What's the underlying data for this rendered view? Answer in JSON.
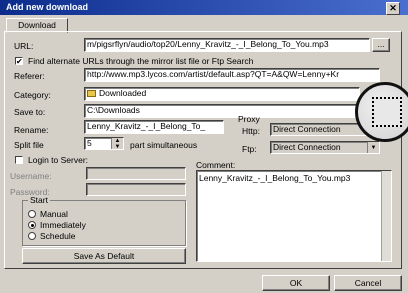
{
  "window": {
    "title": "Add new download",
    "close_glyph": "✕"
  },
  "tabs": [
    "Download"
  ],
  "url": {
    "label": "URL:",
    "value": "m/pigsrflyn/audio/top20/Lenny_Kravitz_-_I_Belong_To_You.mp3",
    "browse": "..."
  },
  "mirror": {
    "checked": true,
    "label": "Find alternate URLs through the mirror list file or Ftp Search"
  },
  "referer": {
    "label": "Referer:",
    "value": "http://www.mp3.lycos.com/artist/default.asp?QT=A&QW=Lenny+Kr"
  },
  "category": {
    "label": "Category:",
    "value": "Downloaded"
  },
  "save_to": {
    "label": "Save to:",
    "value": "C:\\Downloads"
  },
  "rename": {
    "label": "Rename:",
    "value": "Lenny_Kravitz_-_I_Belong_To_"
  },
  "split": {
    "label": "Split file",
    "value": "5",
    "suffix": "part simultaneous"
  },
  "proxy": {
    "label": "Proxy",
    "http_label": "Http:",
    "http_value": "Direct Connection",
    "ftp_label": "Ftp:",
    "ftp_value": "Direct Connection"
  },
  "login": {
    "label": "Login to Server:",
    "checked": false,
    "username_label": "Username:",
    "password_label": "Password:"
  },
  "comment": {
    "label": "Comment:",
    "value": "Lenny_Kravitz_-_I_Belong_To_You.mp3"
  },
  "start": {
    "label": "Start",
    "options": [
      "Manual",
      "Immediately",
      "Schedule"
    ],
    "selected": "Immediately"
  },
  "save_default": "Save As Default",
  "ok": "OK",
  "cancel": "Cancel",
  "icons": {
    "folder": "folder-icon",
    "close": "close-icon",
    "lens": "magnifier-icon"
  }
}
